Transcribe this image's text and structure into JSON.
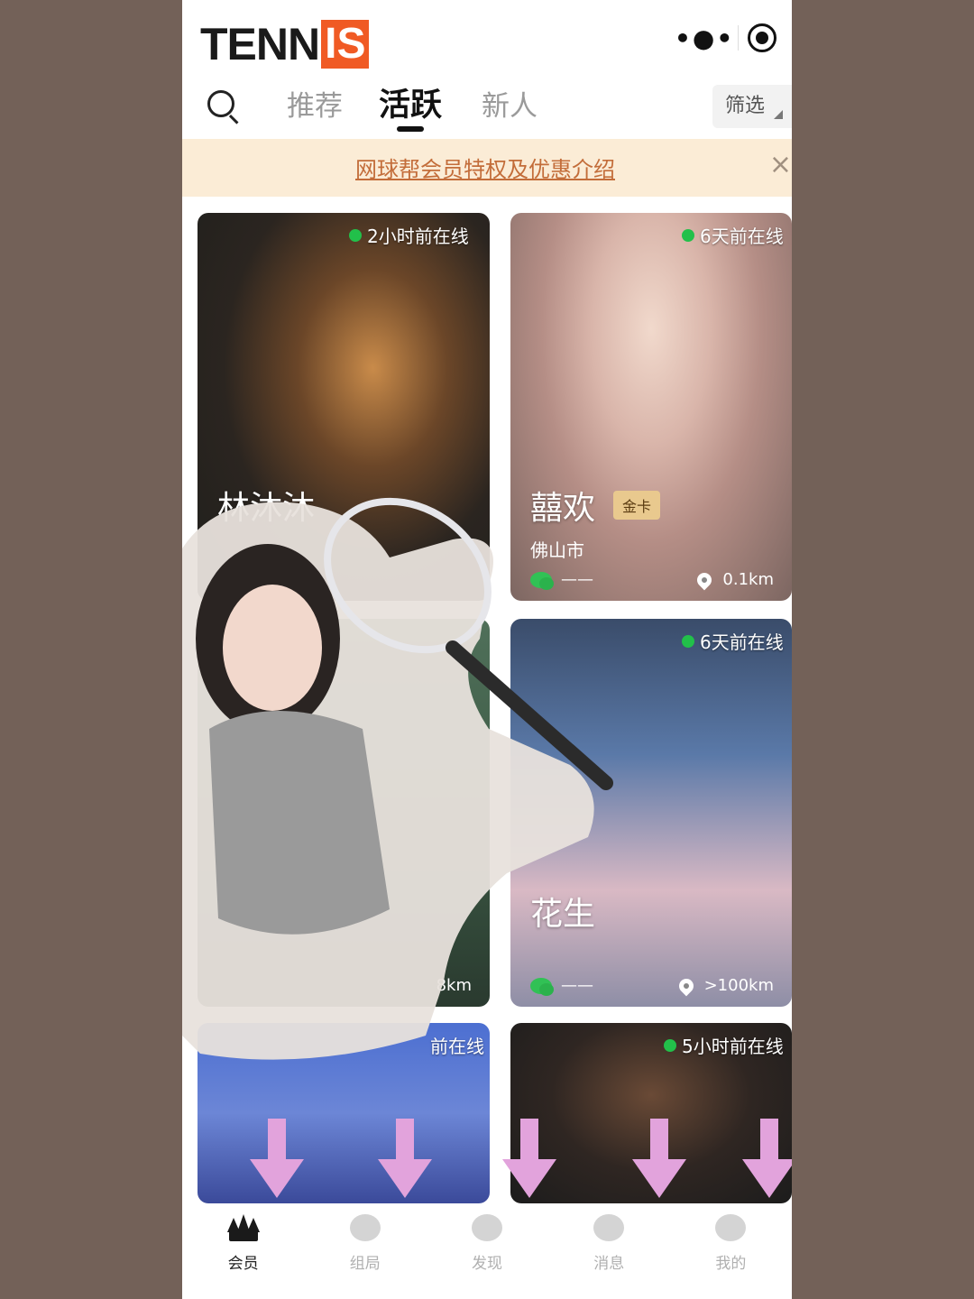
{
  "header": {
    "logo_part1": "TENN",
    "logo_part2": "IS",
    "menu_glyph": "•●•"
  },
  "tabs": [
    {
      "label": "推荐",
      "active": false
    },
    {
      "label": "活跃",
      "active": true
    },
    {
      "label": "新人",
      "active": false
    }
  ],
  "filter_label": "筛选",
  "banner": {
    "text": "网球帮会员特权及优惠介绍",
    "close": "×"
  },
  "cards": [
    {
      "online": "2小时前在线",
      "name": "林沐沐"
    },
    {
      "online": "6天前在线",
      "name": "囍欢",
      "badge": "金卡",
      "city": "佛山市",
      "wechat": "——",
      "distance": "0.1km"
    },
    {
      "distance": "8km"
    },
    {
      "online": "6天前在线",
      "name": "花生",
      "wechat": "——",
      "distance": ">100km"
    },
    {
      "online": "前在线"
    },
    {
      "online": "5小时前在线"
    }
  ],
  "nav": [
    {
      "label": "会员",
      "icon": "crown-icon",
      "active": true
    },
    {
      "label": "组局",
      "icon": "group-icon",
      "active": false
    },
    {
      "label": "发现",
      "icon": "planet-icon",
      "active": false
    },
    {
      "label": "消息",
      "icon": "chat-icon",
      "active": false
    },
    {
      "label": "我的",
      "icon": "profile-icon",
      "active": false
    }
  ],
  "colors": {
    "page_bg": "#736158",
    "brand_orange": "#f05a24",
    "online_green": "#22c04a",
    "banner_bg": "#fbecd6",
    "banner_text": "#c36d3a",
    "gold_badge": "#e9c98e"
  }
}
